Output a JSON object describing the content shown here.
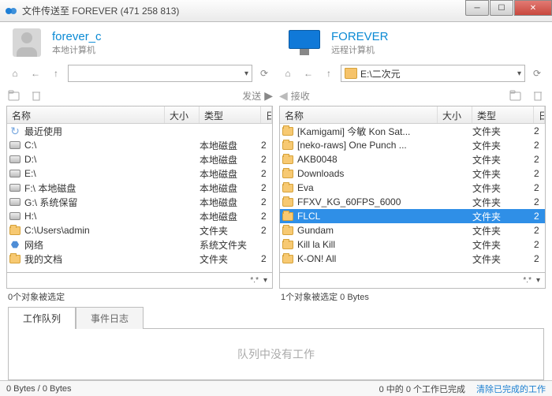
{
  "title": "文件传送至 FOREVER (471 258 813)",
  "local": {
    "name": "forever_c",
    "sub": "本地计算机",
    "address": "",
    "cols": {
      "name": "名称",
      "size": "大小",
      "type": "类型",
      "date": "日"
    },
    "items": [
      {
        "icon": "recent",
        "name": "最近使用",
        "type": "",
        "date": ""
      },
      {
        "icon": "drive",
        "name": "C:\\",
        "type": "本地磁盘",
        "date": "2"
      },
      {
        "icon": "drive",
        "name": "D:\\",
        "type": "本地磁盘",
        "date": "2"
      },
      {
        "icon": "drive",
        "name": "E:\\",
        "type": "本地磁盘",
        "date": "2"
      },
      {
        "icon": "drive",
        "name": "F:\\  本地磁盘",
        "type": "本地磁盘",
        "date": "2"
      },
      {
        "icon": "drive",
        "name": "G:\\  系统保留",
        "type": "本地磁盘",
        "date": "2"
      },
      {
        "icon": "drive",
        "name": "H:\\",
        "type": "本地磁盘",
        "date": "2"
      },
      {
        "icon": "folder",
        "name": "C:\\Users\\admin",
        "type": "文件夹",
        "date": "2"
      },
      {
        "icon": "net",
        "name": "网络",
        "type": "系统文件夹",
        "date": ""
      },
      {
        "icon": "folder",
        "name": "我的文档",
        "type": "文件夹",
        "date": "2"
      }
    ],
    "filter": "*.*",
    "selstatus": "0个对象被选定"
  },
  "remote": {
    "name": "FOREVER",
    "sub": "远程计算机",
    "address": "E:\\二次元",
    "cols": {
      "name": "名称",
      "size": "大小",
      "type": "类型",
      "date": "日"
    },
    "items": [
      {
        "icon": "folder",
        "name": "[Kamigami] 今敏 Kon Sat...",
        "type": "文件夹",
        "date": "2"
      },
      {
        "icon": "folder",
        "name": "[neko-raws] One Punch ...",
        "type": "文件夹",
        "date": "2"
      },
      {
        "icon": "folder",
        "name": "AKB0048",
        "type": "文件夹",
        "date": "2"
      },
      {
        "icon": "folder",
        "name": "Downloads",
        "type": "文件夹",
        "date": "2"
      },
      {
        "icon": "folder",
        "name": "Eva",
        "type": "文件夹",
        "date": "2"
      },
      {
        "icon": "folder",
        "name": "FFXV_KG_60FPS_6000",
        "type": "文件夹",
        "date": "2"
      },
      {
        "icon": "folder",
        "name": "FLCL",
        "type": "文件夹",
        "date": "2",
        "selected": true
      },
      {
        "icon": "folder",
        "name": "Gundam",
        "type": "文件夹",
        "date": "2"
      },
      {
        "icon": "folder",
        "name": "Kill la Kill",
        "type": "文件夹",
        "date": "2"
      },
      {
        "icon": "folder",
        "name": "K-ON! All",
        "type": "文件夹",
        "date": "2"
      }
    ],
    "filter": "*.*",
    "selstatus": "1个对象被选定  0 Bytes"
  },
  "actions": {
    "send": "发送",
    "recv": "接收"
  },
  "tabs": {
    "queue": "工作队列",
    "log": "事件日志"
  },
  "queue_empty": "队列中没有工作",
  "footer": {
    "left": "0 Bytes / 0 Bytes",
    "mid": "0 中的 0 个工作已完成",
    "link": "清除已完成的工作"
  }
}
